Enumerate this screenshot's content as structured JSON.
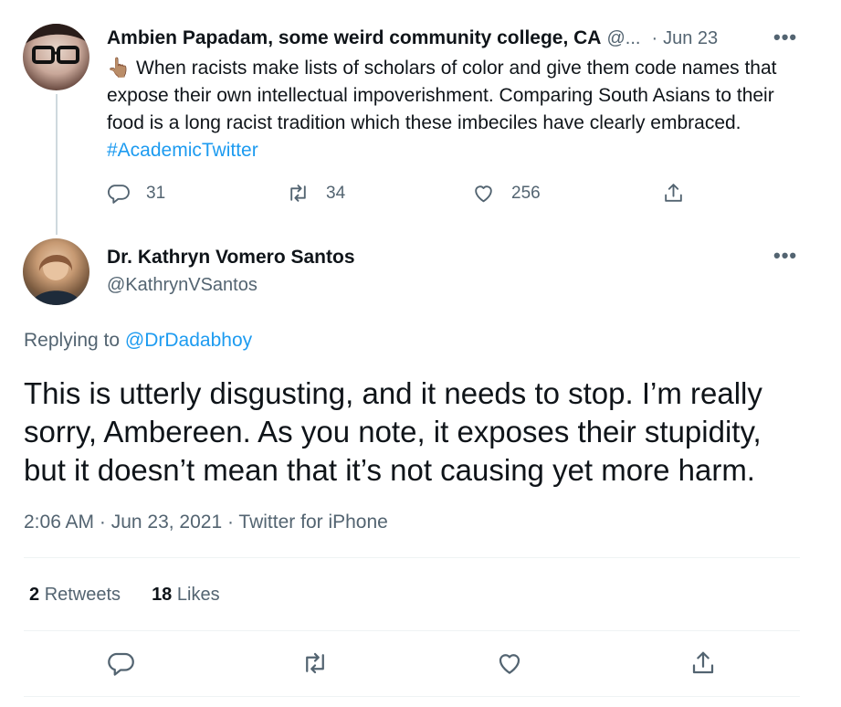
{
  "parent_tweet": {
    "display_name": "Ambien Papadam, some weird community college, CA",
    "handle_truncated": "@...",
    "separator": "·",
    "date": "Jun 23",
    "more_label": "•••",
    "emoji": "👆🏽",
    "text_before_hashtag": "When racists make lists of scholars of color and give them code names that expose their own intellectual impoverishment. Comparing South Asians to their food is a long racist tradition which these imbeciles have clearly embraced.",
    "hashtag": "#AcademicTwitter",
    "reply_count": "31",
    "retweet_count": "34",
    "like_count": "256"
  },
  "main_tweet": {
    "display_name": "Dr. Kathryn Vomero Santos",
    "handle": "@KathrynVSantos",
    "more_label": "•••",
    "replying_to_label": "Replying to",
    "replying_to_handle": "@DrDadabhoy",
    "text": "This is utterly disgusting, and it needs to stop. I’m really sorry, Ambereen. As you note, it exposes their stupidity, but it doesn’t mean that it’s not causing yet more harm.",
    "timestamp": "2:06 AM · Jun 23, 2021 · Twitter for iPhone",
    "retweets_count": "2",
    "retweets_label": "Retweets",
    "likes_count": "18",
    "likes_label": "Likes"
  },
  "icons": [
    "reply-icon",
    "retweet-icon",
    "like-icon",
    "share-icon",
    "more-icon"
  ],
  "colors": {
    "accent": "#1d9bf0",
    "muted": "#536471",
    "text": "#0f1419",
    "divider": "#eff3f4"
  }
}
